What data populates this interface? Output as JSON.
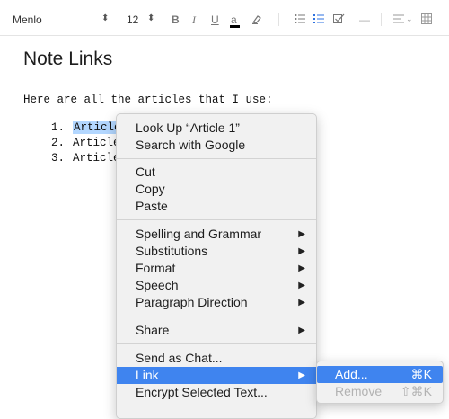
{
  "toolbar": {
    "font_name": "Menlo",
    "font_size": "12",
    "bold_label": "B",
    "italic_label": "I",
    "underline_label": "U",
    "text_color_label": "a"
  },
  "document": {
    "title": "Note Links",
    "intro": "Here are all the articles that I use:",
    "list": [
      {
        "number": "1.",
        "text": "Article 1"
      },
      {
        "number": "2.",
        "text": "Article 2"
      },
      {
        "number": "3.",
        "text": "Article 3"
      }
    ]
  },
  "context_menu": {
    "lookup": "Look Up “Article 1”",
    "search_google": "Search with Google",
    "cut": "Cut",
    "copy": "Copy",
    "paste": "Paste",
    "spelling_grammar": "Spelling and Grammar",
    "substitutions": "Substitutions",
    "format": "Format",
    "speech": "Speech",
    "paragraph_direction": "Paragraph Direction",
    "share": "Share",
    "send_as_chat": "Send as Chat...",
    "link": "Link",
    "encrypt": "Encrypt Selected Text..."
  },
  "link_submenu": {
    "add_label": "Add...",
    "add_shortcut": "⌘K",
    "remove_label": "Remove",
    "remove_shortcut": "⇧⌘K"
  },
  "colors": {
    "selection_highlight": "#b3d7ff",
    "menu_active": "#3f84ef",
    "numbered_list_active": "#2e72e0"
  }
}
